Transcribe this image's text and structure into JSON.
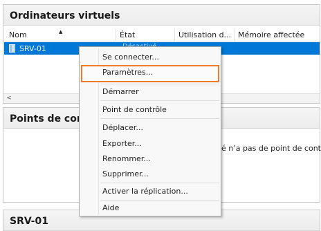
{
  "vm_pane": {
    "title": "Ordinateurs virtuels",
    "columns": [
      "Nom",
      "État",
      "Utilisation d...",
      "Mémoire affectée"
    ],
    "rows": [
      {
        "name": "SRV-01",
        "state": "Désactivé"
      }
    ]
  },
  "checkpoint_pane": {
    "title": "Points de contrôle",
    "note": "né n’a pas de point de contrôle"
  },
  "detail_pane": {
    "title": "SRV-01"
  },
  "context_menu": {
    "items": [
      "Se connecter...",
      "Paramètres...",
      "Démarrer",
      "Point de contrôle",
      "Déplacer...",
      "Exporter...",
      "Renommer...",
      "Supprimer...",
      "Activer la réplication...",
      "Aide"
    ],
    "highlighted_item": "Paramètres...",
    "highlight_color": "#f07a2a"
  },
  "colors": {
    "selection": "#0078d7"
  },
  "icons": {
    "sort": "sort-ascending-icon",
    "vm": "virtual-machine-icon",
    "scroll_left": "chevron-left-icon"
  }
}
